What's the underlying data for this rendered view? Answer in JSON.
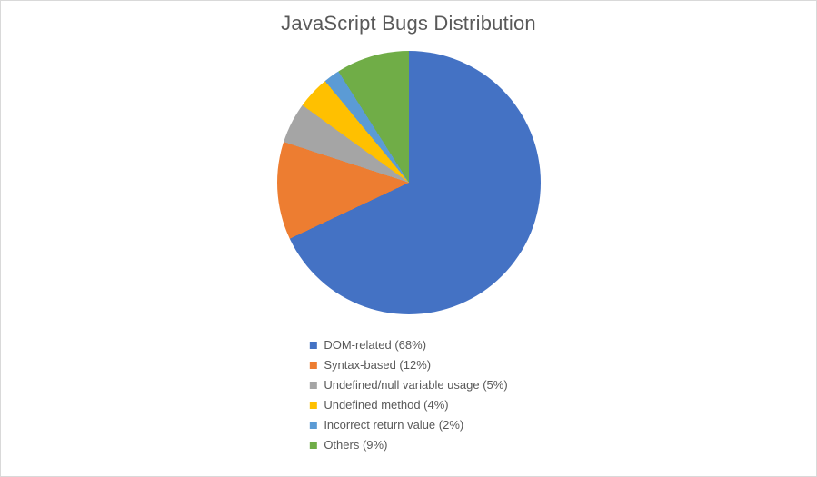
{
  "chart_data": {
    "type": "pie",
    "title": "JavaScript Bugs Distribution",
    "series": [
      {
        "name": "DOM-related",
        "value": 68,
        "color": "#4472C4"
      },
      {
        "name": "Syntax-based",
        "value": 12,
        "color": "#ED7D31"
      },
      {
        "name": "Undefined/null variable usage",
        "value": 5,
        "color": "#A5A5A5"
      },
      {
        "name": "Undefined method",
        "value": 4,
        "color": "#FFC000"
      },
      {
        "name": "Incorrect return value",
        "value": 2,
        "color": "#5B9BD5"
      },
      {
        "name": "Others",
        "value": 9,
        "color": "#70AD47"
      }
    ],
    "legend_labels": [
      "DOM-related (68%)",
      "Syntax-based (12%)",
      "Undefined/null variable usage (5%)",
      "Undefined method (4%)",
      "Incorrect return value (2%)",
      "Others (9%)"
    ]
  }
}
